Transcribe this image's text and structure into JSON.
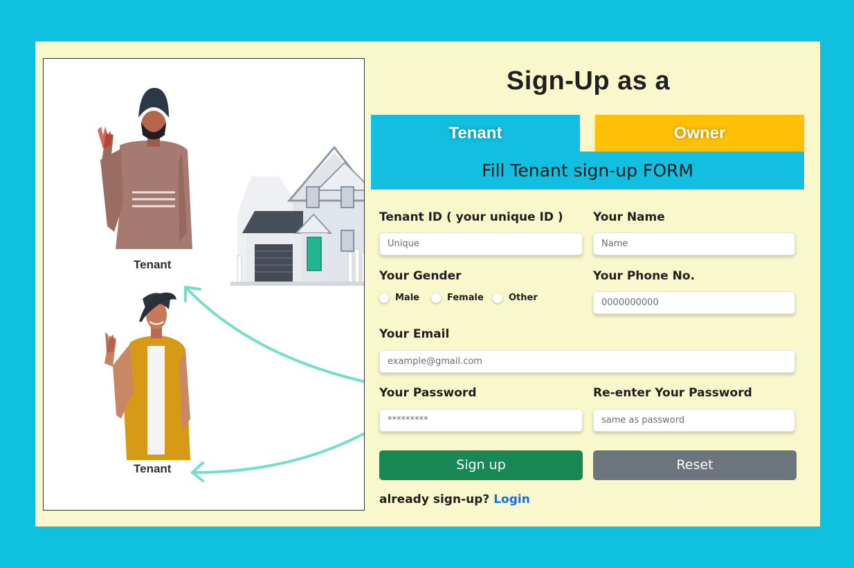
{
  "illustration": {
    "label_top": "Tenant",
    "label_bottom": "Tenant"
  },
  "header": {
    "title": "Sign-Up as a"
  },
  "tabs": [
    {
      "label": "Tenant",
      "active": true,
      "color": "#13bfe0"
    },
    {
      "label": "Owner",
      "active": false,
      "color": "#ffc107"
    }
  ],
  "form": {
    "banner": "Fill Tenant sign-up FORM",
    "tenant_id": {
      "label": "Tenant ID ( your unique ID )",
      "placeholder": "Unique"
    },
    "name": {
      "label": "Your Name",
      "placeholder": "Name"
    },
    "gender": {
      "label": "Your Gender",
      "options": [
        "Male",
        "Female",
        "Other"
      ]
    },
    "phone": {
      "label": "Your Phone No.",
      "placeholder": "0000000000"
    },
    "email": {
      "label": "Your Email",
      "placeholder": "example@gmail.com"
    },
    "password": {
      "label": "Your Password",
      "placeholder": "*********"
    },
    "confirm_password": {
      "label": "Re-enter Your Password",
      "placeholder": "same as password"
    },
    "signup_button": "Sign up",
    "reset_button": "Reset",
    "login_prompt": "already sign-up?",
    "login_link": "Login"
  },
  "colors": {
    "page_bg": "#0fc0df",
    "card_bg": "#f8f8cc",
    "signup": "#198754",
    "reset": "#6c757d",
    "link": "#0d6efd"
  }
}
